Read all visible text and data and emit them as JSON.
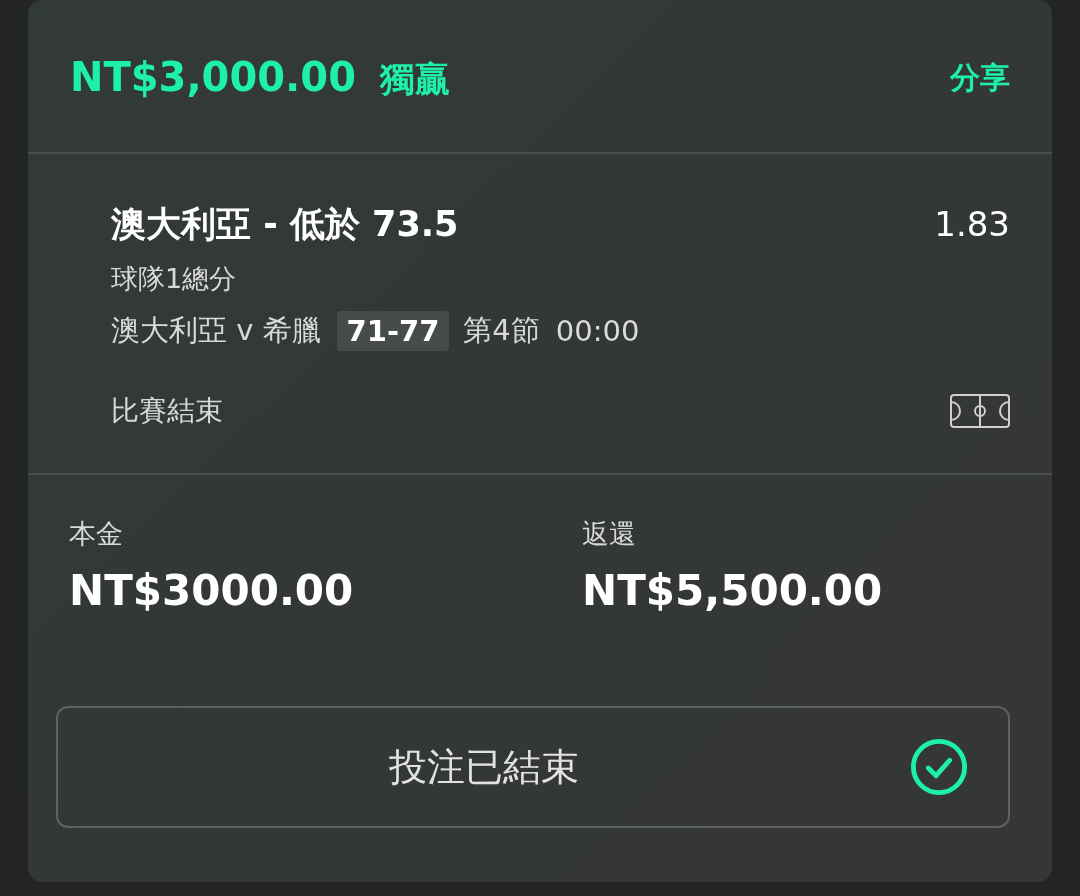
{
  "header": {
    "amount": "NT$3,000.00",
    "bet_type": "獨贏",
    "share_link": "分享"
  },
  "selection": {
    "title": "澳大利亞 - 低於 73.5",
    "odds": "1.83",
    "market": "球隊1總分",
    "match": "澳大利亞 v 希臘",
    "score": "71-77",
    "period": "第4節",
    "clock": "00:00",
    "status": "比賽結束"
  },
  "stakes": [
    {
      "label": "本金",
      "value": "NT$3000.00"
    },
    {
      "label": "返還",
      "value": "NT$5,500.00"
    }
  ],
  "status_button": {
    "label": "投注已結束"
  }
}
